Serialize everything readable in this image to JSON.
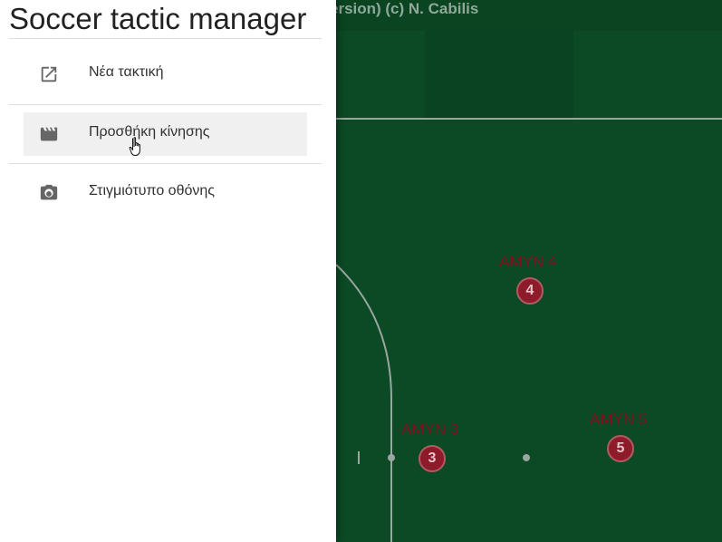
{
  "app": {
    "title": "Soccer tactic manager",
    "toolbar_title_fragment": "ersion) (c) N. Cabilis"
  },
  "menu": {
    "items": [
      {
        "label": "Νέα τακτική",
        "icon": "open-in-new-icon",
        "hovered": false
      },
      {
        "label": "Προσθήκη κίνησης",
        "icon": "movie-clapperboard-icon",
        "hovered": true
      },
      {
        "label": "Στιγμιότυπο οθόνης",
        "icon": "camera-icon",
        "hovered": false
      }
    ]
  },
  "players": [
    {
      "number": "4",
      "label": "ΑΜΥΝ 4"
    },
    {
      "number": "3",
      "label": "ΑΜΥΝ 3"
    },
    {
      "number": "5",
      "label": "ΑΜΥΝ 5"
    }
  ],
  "colors": {
    "pitch": "#0b4a25",
    "player_fill": "#8e1b29",
    "player_label": "#7a1220",
    "drawer_bg": "#ffffff"
  }
}
